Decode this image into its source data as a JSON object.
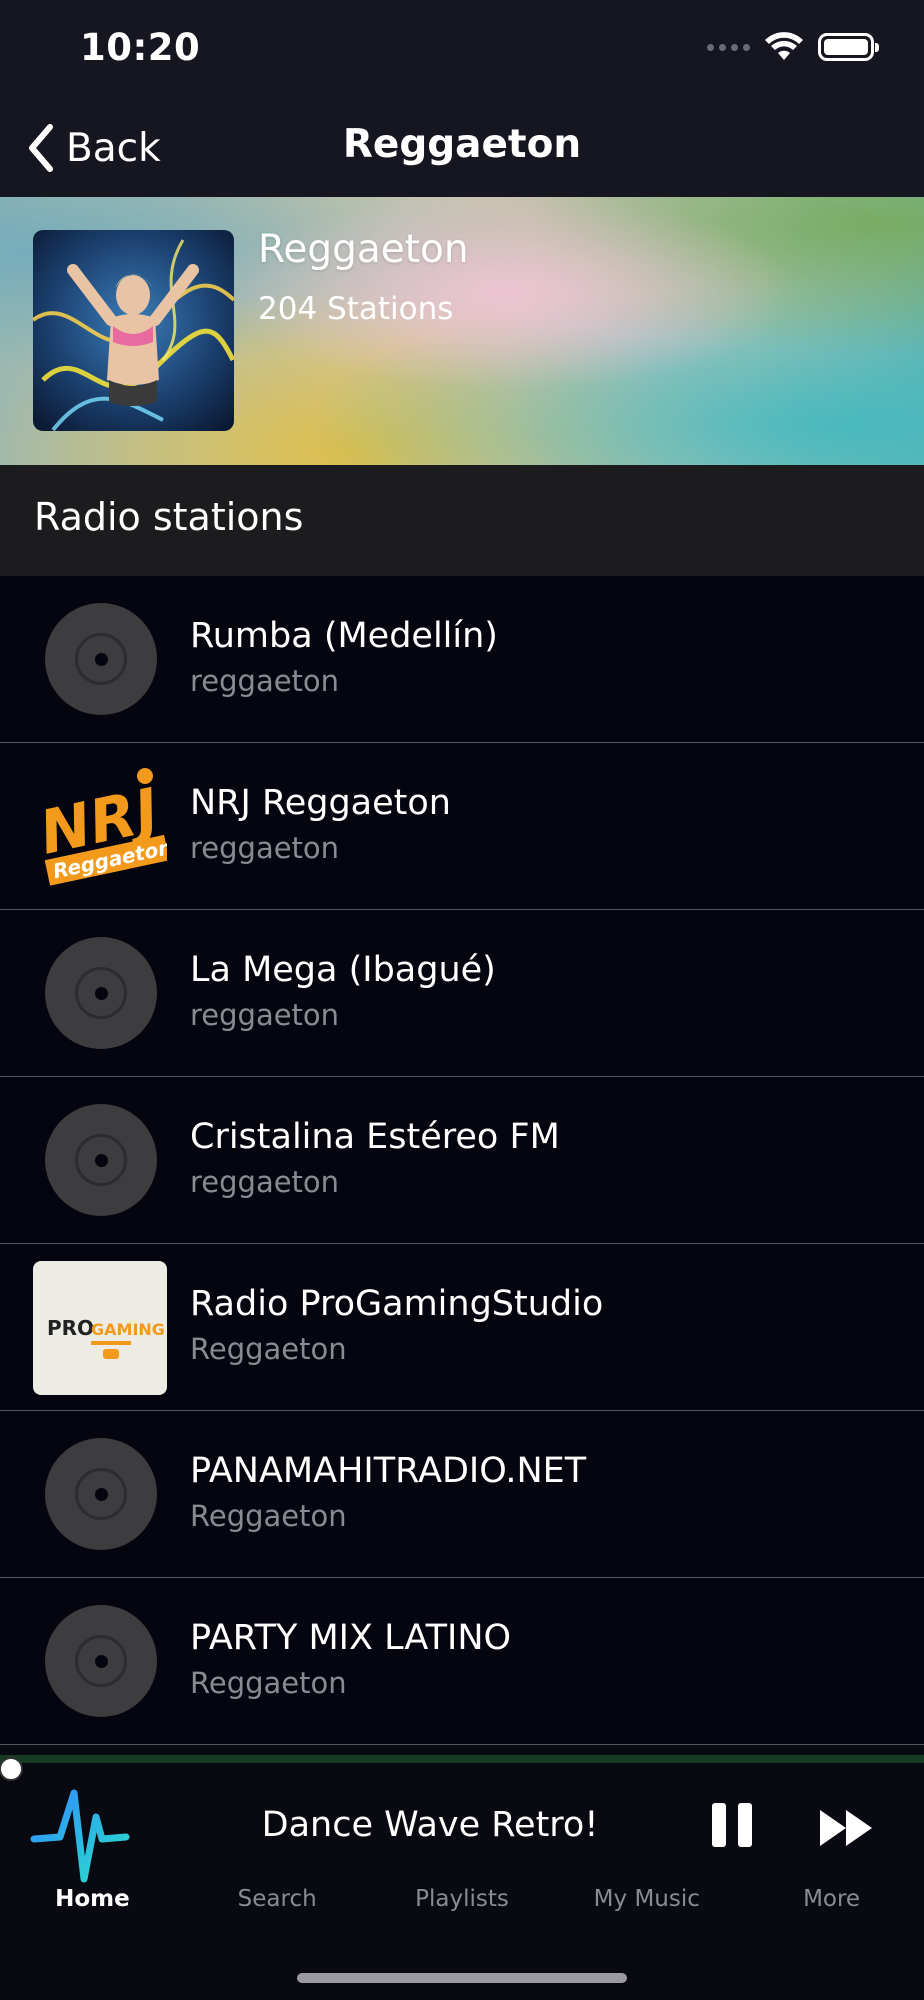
{
  "status_bar": {
    "time": "10:20"
  },
  "nav": {
    "back_label": "Back",
    "title": "Reggaeton"
  },
  "genre": {
    "name": "Reggaeton",
    "station_count": "204 Stations"
  },
  "section": {
    "title": "Radio stations"
  },
  "stations": [
    {
      "name": "Rumba (Medellín)",
      "genre": "reggaeton",
      "art": "disc"
    },
    {
      "name": "NRJ Reggaeton",
      "genre": "reggaeton",
      "art": "nrj-logo",
      "logo_text": "NRJ",
      "logo_sub": "Reggaeton"
    },
    {
      "name": "La Mega (Ibagué)",
      "genre": "reggaeton",
      "art": "disc"
    },
    {
      "name": "Cristalina Estéreo FM",
      "genre": "reggaeton",
      "art": "disc"
    },
    {
      "name": "Radio ProGamingStudio",
      "genre": "Reggaeton",
      "art": "progaming-logo",
      "logo_pre": "PRO",
      "logo_main": "GAMING"
    },
    {
      "name": "PANAMAHITRADIO.NET",
      "genre": "Reggaeton",
      "art": "disc"
    },
    {
      "name": "PARTY MIX LATINO",
      "genre": "Reggaeton",
      "art": "disc"
    }
  ],
  "player": {
    "now_playing": "Dance Wave Retro!",
    "progress": 0.0
  },
  "tabs": [
    {
      "label": "Home",
      "active": true
    },
    {
      "label": "Search",
      "active": false
    },
    {
      "label": "Playlists",
      "active": false
    },
    {
      "label": "My Music",
      "active": false
    },
    {
      "label": "More",
      "active": false
    }
  ],
  "colors": {
    "background": "#05050f",
    "bar": "#161620",
    "accent_progress": "#1f5e30",
    "nrj_orange": "#f39a1d"
  }
}
